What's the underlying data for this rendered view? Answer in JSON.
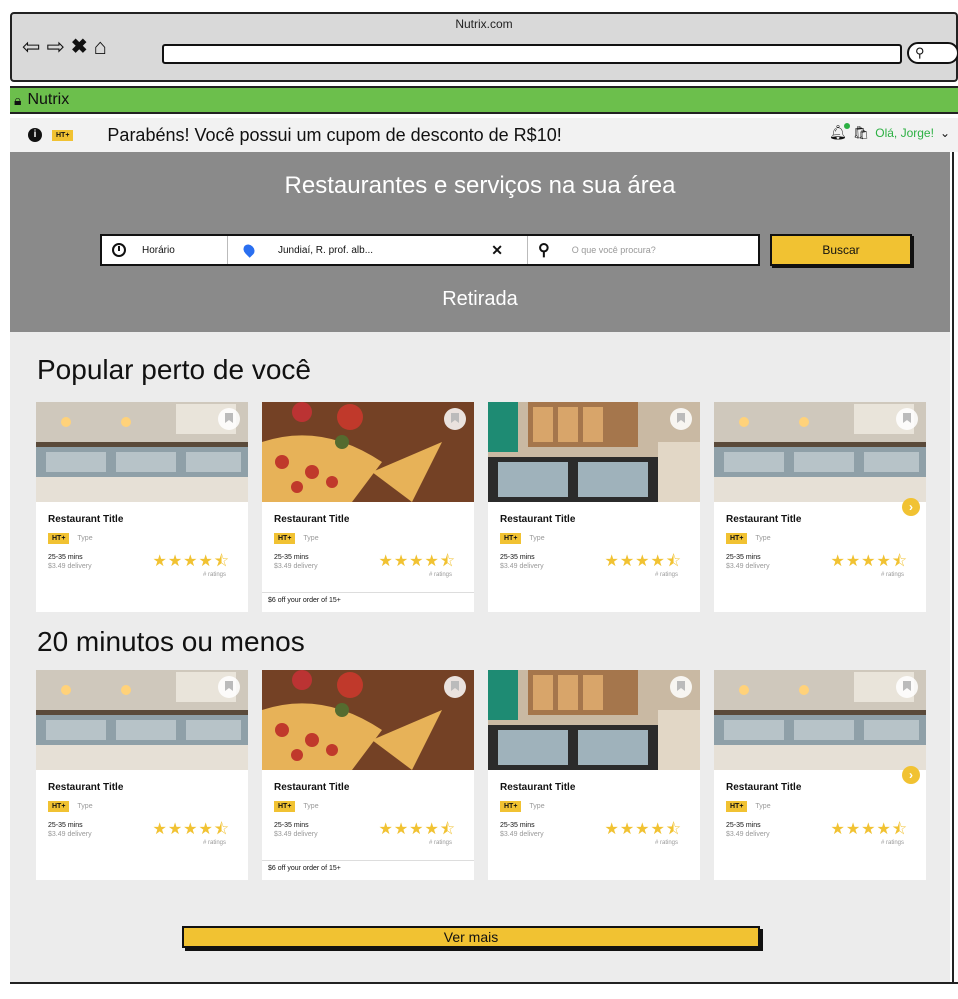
{
  "browser": {
    "site_title": "Nutrix.com",
    "nav_icons": [
      "back-icon",
      "forward-icon",
      "close-icon",
      "home-icon"
    ]
  },
  "tab": {
    "name": "Nutrix"
  },
  "notice": {
    "badge": "HT+",
    "message": "Parabéns! Você possui um cupom de desconto de R$10!",
    "greeting": "Olá, Jorge!"
  },
  "hero": {
    "headline": "Restaurantes e serviços na sua área",
    "time_label": "Horário",
    "location_value": "Jundiaí, R. prof. alb...",
    "search_placeholder": "O que você procura?",
    "search_button": "Buscar",
    "mode_label": "Retirada"
  },
  "sections": [
    {
      "title": "Popular perto de você",
      "cards": [
        {
          "title": "Restaurant Title",
          "badge": "HT+",
          "type": "Type",
          "time": "25-35 mins",
          "delivery": "$3.49 delivery",
          "ratings": "# ratings",
          "promo": "",
          "image": "pizza-shop"
        },
        {
          "title": "Restaurant Title",
          "badge": "HT+",
          "type": "Type",
          "time": "25-35 mins",
          "delivery": "$3.49 delivery",
          "ratings": "# ratings",
          "promo": "$6 off your order of 15+",
          "image": "pizza"
        },
        {
          "title": "Restaurant Title",
          "badge": "HT+",
          "type": "Type",
          "time": "25-35 mins",
          "delivery": "$3.49 delivery",
          "ratings": "# ratings",
          "promo": "",
          "image": "bakery"
        },
        {
          "title": "Restaurant Title",
          "badge": "HT+",
          "type": "Type",
          "time": "25-35 mins",
          "delivery": "$3.49 delivery",
          "ratings": "# ratings",
          "promo": "",
          "image": "pizza-shop"
        }
      ]
    },
    {
      "title": "20 minutos ou menos",
      "cards": [
        {
          "title": "Restaurant Title",
          "badge": "HT+",
          "type": "Type",
          "time": "25-35 mins",
          "delivery": "$3.49 delivery",
          "ratings": "# ratings",
          "promo": "",
          "image": "pizza-shop"
        },
        {
          "title": "Restaurant Title",
          "badge": "HT+",
          "type": "Type",
          "time": "25-35 mins",
          "delivery": "$3.49 delivery",
          "ratings": "# ratings",
          "promo": "$6 off your order of 15+",
          "image": "pizza"
        },
        {
          "title": "Restaurant Title",
          "badge": "HT+",
          "type": "Type",
          "time": "25-35 mins",
          "delivery": "$3.49 delivery",
          "ratings": "# ratings",
          "promo": "",
          "image": "bakery"
        },
        {
          "title": "Restaurant Title",
          "badge": "HT+",
          "type": "Type",
          "time": "25-35 mins",
          "delivery": "$3.49 delivery",
          "ratings": "# ratings",
          "promo": "",
          "image": "pizza-shop"
        }
      ]
    }
  ],
  "rating_stars": 4.5,
  "more_button": "Ver mais",
  "colors": {
    "accent_yellow": "#f1c232",
    "tab_green": "#6cbf4c",
    "hero_gray": "#8a8a8a",
    "greeting_green": "#2cb043"
  }
}
